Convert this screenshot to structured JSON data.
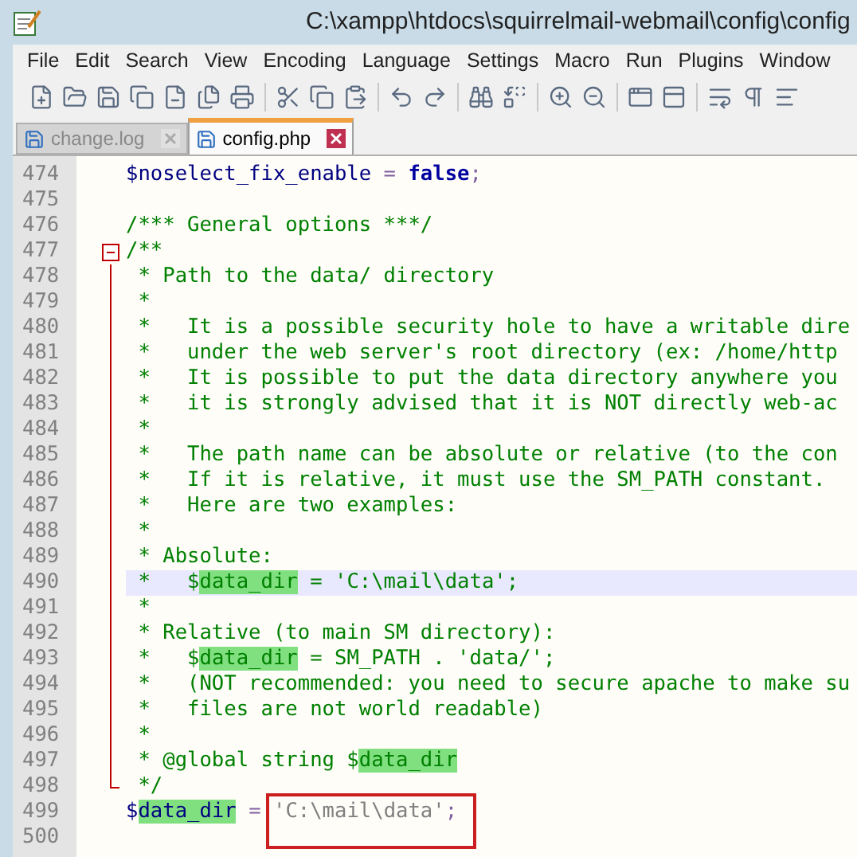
{
  "window": {
    "title": "C:\\xampp\\htdocs\\squirrelmail-webmail\\config\\config"
  },
  "menu": [
    "File",
    "Edit",
    "Search",
    "View",
    "Encoding",
    "Language",
    "Settings",
    "Macro",
    "Run",
    "Plugins",
    "Window"
  ],
  "tabs": [
    {
      "label": "change.log",
      "selected": false
    },
    {
      "label": "config.php",
      "selected": true
    }
  ],
  "lines": [
    {
      "number": "474",
      "current": false,
      "segments": [
        {
          "kind": "var",
          "text": "$noselect_fix_enable"
        },
        {
          "kind": "operator",
          "text": " = "
        },
        {
          "kind": "keyword",
          "text": "false"
        },
        {
          "kind": "operator",
          "text": ";"
        }
      ]
    },
    {
      "number": "475",
      "current": false
    },
    {
      "number": "476",
      "current": false,
      "segments": [
        {
          "kind": "comment",
          "text": "/*** General options ***/"
        }
      ]
    },
    {
      "number": "477",
      "current": false,
      "expanded": true,
      "segments": [
        {
          "kind": "comment",
          "text": "/**"
        }
      ],
      "children": [
        {
          "number": "478",
          "current": false,
          "segments": [
            {
              "kind": "comment",
              "text": " * Path to the data/ directory"
            }
          ]
        },
        {
          "number": "479",
          "current": false,
          "segments": [
            {
              "kind": "comment",
              "text": " *"
            }
          ]
        },
        {
          "number": "480",
          "current": false,
          "segments": [
            {
              "kind": "comment",
              "text": " *   It is a possible security hole to have a writable dire"
            }
          ]
        },
        {
          "number": "481",
          "current": false,
          "segments": [
            {
              "kind": "comment",
              "text": " *   under the web server's root directory (ex: /home/http"
            }
          ]
        },
        {
          "number": "482",
          "current": false,
          "segments": [
            {
              "kind": "comment",
              "text": " *   It is possible to put the data directory anywhere you"
            }
          ]
        },
        {
          "number": "483",
          "current": false,
          "segments": [
            {
              "kind": "comment",
              "text": " *   it is strongly advised that it is NOT directly web-ac"
            }
          ]
        },
        {
          "number": "484",
          "current": false,
          "segments": [
            {
              "kind": "comment",
              "text": " *"
            }
          ]
        },
        {
          "number": "485",
          "current": false,
          "segments": [
            {
              "kind": "comment",
              "text": " *   The path name can be absolute or relative (to the con"
            }
          ]
        },
        {
          "number": "486",
          "current": false,
          "segments": [
            {
              "kind": "comment",
              "text": " *   If it is relative, it must use the SM_PATH constant."
            }
          ]
        },
        {
          "number": "487",
          "current": false,
          "segments": [
            {
              "kind": "comment",
              "text": " *   Here are two examples:"
            }
          ]
        },
        {
          "number": "488",
          "current": false,
          "segments": [
            {
              "kind": "comment",
              "text": " *"
            }
          ]
        },
        {
          "number": "489",
          "current": false,
          "segments": [
            {
              "kind": "comment",
              "text": " * Absolute:"
            }
          ]
        },
        {
          "number": "490",
          "current": true,
          "segments": [
            {
              "kind": "comment",
              "text": " *   $"
            },
            {
              "kind": "match",
              "text": "data_dir"
            },
            {
              "kind": "comment",
              "text": " = 'C:\\mail\\data';"
            }
          ]
        },
        {
          "number": "491",
          "current": false,
          "segments": [
            {
              "kind": "comment",
              "text": " *"
            }
          ]
        },
        {
          "number": "492",
          "current": false,
          "segments": [
            {
              "kind": "comment",
              "text": " * Relative (to main SM directory):"
            }
          ]
        },
        {
          "number": "493",
          "current": false,
          "segments": [
            {
              "kind": "comment",
              "text": " *   $"
            },
            {
              "kind": "match",
              "text": "data_dir"
            },
            {
              "kind": "comment",
              "text": " = SM_PATH . 'data/';"
            }
          ]
        },
        {
          "number": "494",
          "current": false,
          "segments": [
            {
              "kind": "comment",
              "text": " *   (NOT recommended: you need to secure apache to make su"
            }
          ]
        },
        {
          "number": "495",
          "current": false,
          "segments": [
            {
              "kind": "comment",
              "text": " *   files are not world readable)"
            }
          ]
        },
        {
          "number": "496",
          "current": false,
          "segments": [
            {
              "kind": "comment",
              "text": " *"
            }
          ]
        },
        {
          "number": "497",
          "current": false,
          "segments": [
            {
              "kind": "comment",
              "text": " * @global string $"
            },
            {
              "kind": "match",
              "text": "data_dir"
            }
          ]
        },
        {
          "number": "498",
          "current": false,
          "segments": [
            {
              "kind": "comment",
              "text": " */"
            }
          ]
        }
      ]
    },
    {
      "number": "499",
      "current": false,
      "segments": [
        {
          "kind": "var",
          "text": "$"
        },
        {
          "kind": "varmatch",
          "text": "data_dir"
        },
        {
          "kind": "operator",
          "text": " = "
        },
        {
          "kind": "string",
          "text": "'C:\\mail\\data'",
          "boxed": true
        },
        {
          "kind": "operator",
          "text": ";"
        }
      ]
    },
    {
      "number": "500",
      "current": false
    }
  ]
}
